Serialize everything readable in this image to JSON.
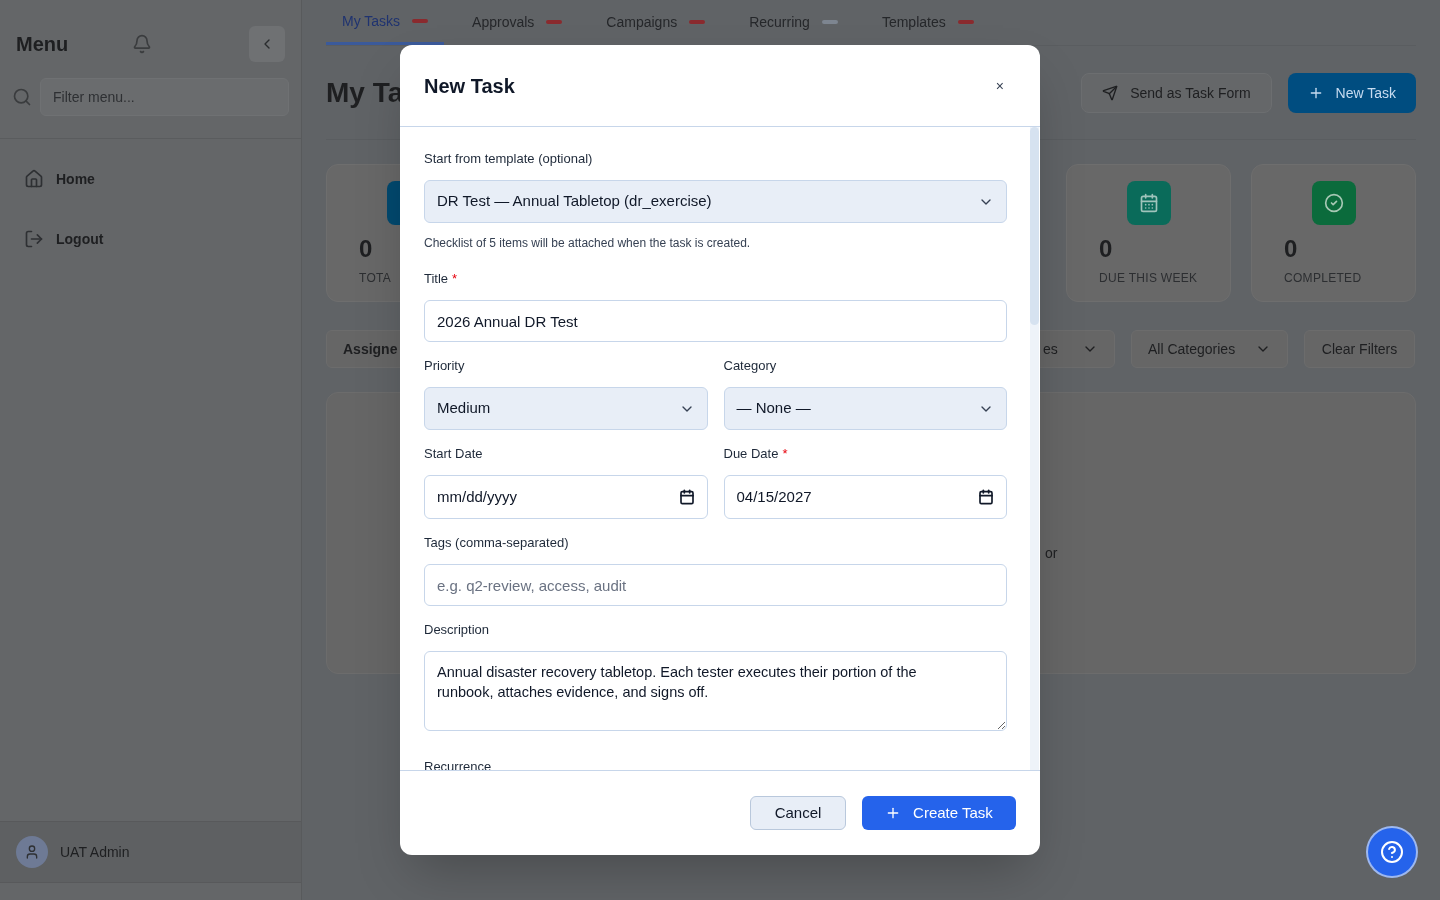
{
  "sidebar": {
    "title": "Menu",
    "filter": {
      "placeholder": "Filter menu..."
    },
    "items": [
      {
        "label": "Home"
      },
      {
        "label": "Logout"
      }
    ],
    "user": {
      "name": "UAT Admin"
    }
  },
  "tabs": [
    {
      "label": "My Tasks",
      "selected": true,
      "color": "#8a2a2e"
    },
    {
      "label": "Approvals",
      "selected": false,
      "color": "#8a2a2e"
    },
    {
      "label": "Campaigns",
      "selected": false,
      "color": "#8a2a2e"
    },
    {
      "label": "Recurring",
      "selected": false,
      "color": "#7d8590"
    },
    {
      "label": "Templates",
      "selected": false,
      "color": "#8a2a2e"
    }
  ],
  "page": {
    "title": "My Ta",
    "actions": [
      {
        "kind": "secondary",
        "label": "Send as Task Form"
      },
      {
        "kind": "primary",
        "label": "New Task"
      }
    ],
    "cards": [
      {
        "value": "0",
        "label": "TOTA",
        "color": "#02496f"
      },
      {
        "value": "0",
        "label": "DUE THIS WEEK",
        "color": "#0a6b5a"
      },
      {
        "value": "0",
        "label": "COMPLETED",
        "color": "#0b6b3c"
      }
    ],
    "filters": [
      {
        "kind": "text",
        "label": "Assigne"
      },
      {
        "kind": "select",
        "label": "es"
      },
      {
        "kind": "select",
        "label": "All Categories"
      },
      {
        "kind": "button",
        "label": "Clear Filters"
      }
    ],
    "panel_text": "or"
  },
  "modal": {
    "title": "New Task",
    "close": "×",
    "rows": [
      [
        {
          "kind": "select",
          "label": "Start from template (optional)",
          "value": "DR Test — Annual Tabletop (dr_exercise)",
          "hint": "Checklist of 5 items will be attached when the task is created."
        }
      ],
      [
        {
          "kind": "text",
          "label": "Title",
          "required_mark": "*",
          "value": "2026 Annual DR Test"
        }
      ],
      [
        {
          "kind": "select",
          "label": "Priority",
          "value": "Medium"
        },
        {
          "kind": "select",
          "label": "Category",
          "value": "— None —"
        }
      ],
      [
        {
          "kind": "date",
          "label": "Start Date",
          "placeholder": "mm/dd/yyyy"
        },
        {
          "kind": "date",
          "label": "Due Date",
          "required_mark": "*",
          "value": "04/15/2027"
        }
      ],
      [
        {
          "kind": "text",
          "label": "Tags (comma-separated)",
          "placeholder": "e.g. q2-review, access, audit"
        }
      ],
      [
        {
          "kind": "textarea",
          "label": "Description",
          "value": "Annual disaster recovery tabletop. Each tester executes their portion of the runbook, attaches evidence, and signs off."
        }
      ],
      [
        {
          "kind": "section",
          "label": "Recurrence"
        }
      ]
    ],
    "buttons": [
      {
        "kind": "secondary",
        "label": "Cancel"
      },
      {
        "kind": "primary",
        "label": "Create Task"
      }
    ]
  }
}
